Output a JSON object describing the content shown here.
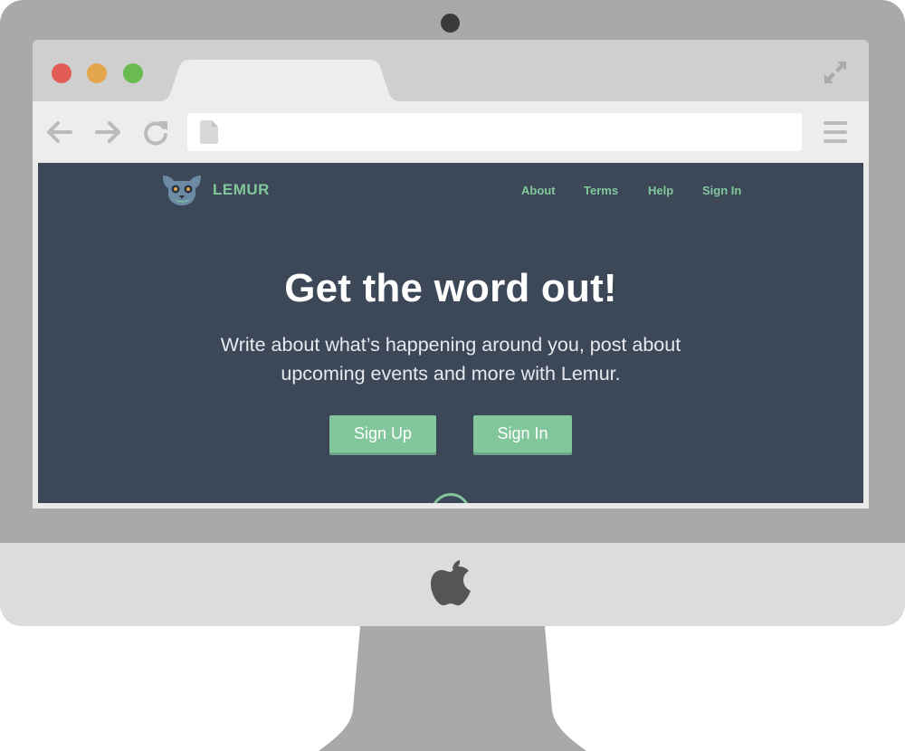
{
  "browser": {
    "address_bar": {
      "value": ""
    }
  },
  "site": {
    "brand_name": "LEMUR",
    "nav": [
      "About",
      "Terms",
      "Help",
      "Sign In"
    ],
    "hero": {
      "title": "Get the word out!",
      "subtitle": "Write about what’s happening around you, post about upcoming events and more with Lemur.",
      "buttons": {
        "signup": "Sign Up",
        "signin": "Sign In"
      }
    }
  },
  "colors": {
    "accent": "#82c79c",
    "page_background": "#3c4858",
    "bezel": "#a9a9a9",
    "chin": "#dcdcdc",
    "traffic_red": "#e05c55",
    "traffic_yellow": "#e3a64c",
    "traffic_green": "#6abb4f"
  },
  "icons": {
    "back": "arrow-left",
    "forward": "arrow-right",
    "reload": "reload",
    "page": "document",
    "menu": "hamburger",
    "expand": "expand-arrows",
    "brand": "lemur-face",
    "hardware_logo": "apple"
  }
}
